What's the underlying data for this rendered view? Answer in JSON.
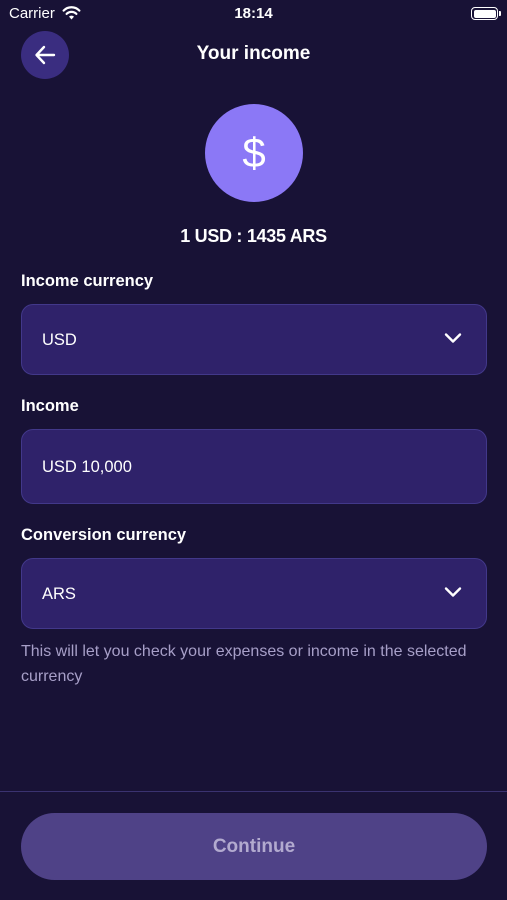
{
  "status_bar": {
    "carrier": "Carrier",
    "time": "18:14"
  },
  "header": {
    "title": "Your income",
    "back_icon": "arrow-left-icon"
  },
  "currency_badge": {
    "symbol": "$",
    "exchange_rate": "1 USD : 1435 ARS"
  },
  "form": {
    "income_currency": {
      "label": "Income currency",
      "value": "USD"
    },
    "income": {
      "label": "Income",
      "value": "USD 10,000"
    },
    "conversion_currency": {
      "label": "Conversion currency",
      "value": "ARS"
    },
    "hint": "This will let you check your expenses or income in the selected currency"
  },
  "footer": {
    "continue_label": "Continue"
  },
  "colors": {
    "background": "#181236",
    "field": "#2f226a",
    "accent": "#8b78f6",
    "button_disabled": "#4f4287"
  }
}
